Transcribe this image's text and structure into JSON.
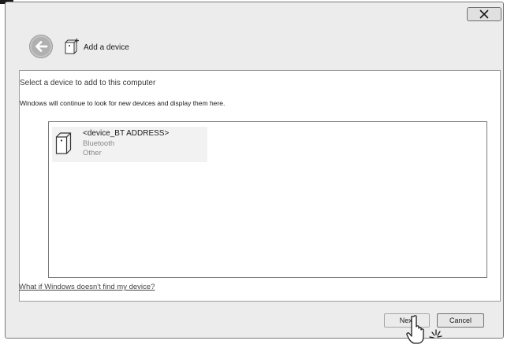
{
  "window": {
    "close_icon": "close-icon",
    "header_title": "Add a device",
    "subtitle": "Select a device to add to this computer",
    "info": "Windows will continue to look for new devices and display them here.",
    "help_link": "What if Windows doesn't find my device?"
  },
  "devices": [
    {
      "name": "<device_BT ADDRESS>",
      "type": "Bluetooth",
      "category": "Other",
      "icon": "device-icon"
    }
  ],
  "buttons": {
    "next": "Next",
    "cancel": "Cancel"
  },
  "icons": {
    "back": "back-arrow-icon",
    "add_device": "add-device-icon",
    "pointer": "hand-pointer-cursor-icon"
  },
  "colors": {
    "window_bg": "#ececec",
    "content_bg": "#ffffff",
    "selected_item": "#f2f2f2",
    "link": "#444444"
  }
}
